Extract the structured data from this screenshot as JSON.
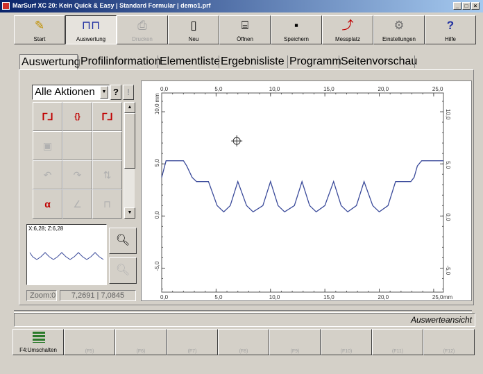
{
  "window": {
    "title": "MarSurf XC 20: Kein Quick & Easy | Standard Formular | demo1.prf"
  },
  "toolbar": {
    "buttons": [
      {
        "label": "Start",
        "icon": "probe-icon",
        "enabled": true
      },
      {
        "label": "Auswertung",
        "icon": "profile-analysis-icon",
        "enabled": true,
        "active": true
      },
      {
        "label": "Drucken",
        "icon": "printer-icon",
        "enabled": false
      },
      {
        "label": "Neu",
        "icon": "new-document-icon",
        "enabled": true
      },
      {
        "label": "Öffnen",
        "icon": "open-folder-icon",
        "enabled": true
      },
      {
        "label": "Speichern",
        "icon": "save-disk-icon",
        "enabled": true
      },
      {
        "label": "Messplatz",
        "icon": "measuring-station-icon",
        "enabled": true
      },
      {
        "label": "Einstellungen",
        "icon": "settings-gears-icon",
        "enabled": true
      },
      {
        "label": "Hilfe",
        "icon": "help-question-icon",
        "enabled": true
      }
    ]
  },
  "tabs": [
    {
      "label": "Auswertung",
      "active": true
    },
    {
      "label": "Profilinformation"
    },
    {
      "label": "Elementliste"
    },
    {
      "label": "Ergebnisliste"
    },
    {
      "label": "Programm"
    },
    {
      "label": "Seitenvorschau"
    }
  ],
  "actions": {
    "select_value": "Alle Aktionen",
    "help_label": "?",
    "excl_label": "!"
  },
  "preview": {
    "coord": "X:6,28; Z:6,28"
  },
  "zoom": {
    "label": "Zoom:0",
    "coords": "7,2691 | 7,0845"
  },
  "status": {
    "text": "Auswerteansicht"
  },
  "fkeys": [
    {
      "label": "F4:Umschalten",
      "enabled": true
    },
    {
      "label": "(F5)"
    },
    {
      "label": "(F6)"
    },
    {
      "label": "(F7)"
    },
    {
      "label": "(F8)"
    },
    {
      "label": "(F9)"
    },
    {
      "label": "(F10)"
    },
    {
      "label": "(F11)"
    },
    {
      "label": "(F12)"
    }
  ],
  "chart_data": {
    "type": "line",
    "xlabel": "mm",
    "ylabel": "mm",
    "xlim": [
      0,
      25.9
    ],
    "ylim": [
      -7.3,
      11.8
    ],
    "x_ticks": [
      "0,0",
      "5,0",
      "10,0",
      "15,0",
      "20,0",
      "25,0"
    ],
    "y_ticks": [
      "-5,0",
      "0,0",
      "5,0",
      "10,0"
    ],
    "crosshair": [
      6.9,
      7.2
    ],
    "series": [
      {
        "color": "#3a4a9a",
        "x": [
          0,
          0.4,
          2.0,
          2.3,
          2.8,
          3.2,
          4.3,
          5.1,
          5.7,
          6.3,
          7.0,
          7.8,
          8.4,
          9.3,
          10.0,
          10.7,
          11.3,
          12.2,
          12.9,
          13.6,
          14.2,
          15.0,
          15.8,
          16.5,
          17.1,
          17.9,
          18.6,
          19.4,
          20.0,
          20.8,
          21.5,
          22.3,
          22.9,
          23.2,
          23.5,
          23.9,
          24.1,
          25.6,
          25.9
        ],
        "y": [
          3.7,
          5.3,
          5.3,
          4.8,
          3.7,
          3.3,
          3.3,
          1.0,
          0.4,
          1.0,
          3.3,
          1.0,
          0.4,
          1.0,
          3.3,
          1.0,
          0.4,
          1.0,
          3.3,
          1.0,
          0.4,
          1.0,
          3.3,
          1.0,
          0.4,
          1.0,
          3.3,
          1.0,
          0.4,
          1.0,
          3.3,
          3.3,
          3.3,
          3.7,
          4.8,
          5.3,
          5.3,
          5.3,
          5.3
        ]
      }
    ]
  }
}
